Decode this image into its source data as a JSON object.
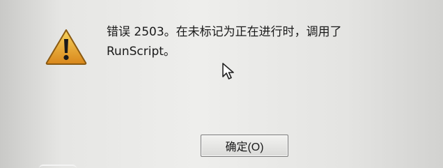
{
  "dialog": {
    "icon": "warning-icon",
    "message_line1": "错误 2503。在未标记为正在进行时，调用了",
    "message_line2": "RunScript。",
    "ok_button_label": "确定(O)",
    "warning_color": "#e4a427"
  },
  "pointer": {
    "icon": "mouse-pointer-icon"
  }
}
